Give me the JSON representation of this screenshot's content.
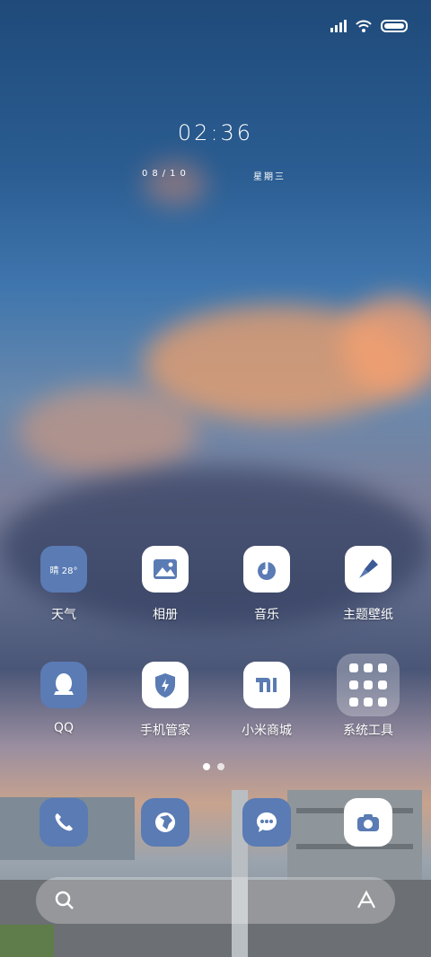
{
  "status": {
    "icons": [
      "signal-icon",
      "wifi-icon",
      "battery-icon"
    ]
  },
  "clock": {
    "time": "02:36"
  },
  "date": {
    "day": "08/10",
    "weekday": "星期三"
  },
  "apps": {
    "row1": [
      {
        "label": "天气",
        "weather_text": "晴 28°"
      },
      {
        "label": "相册"
      },
      {
        "label": "音乐"
      },
      {
        "label": "主题壁纸"
      }
    ],
    "row2": [
      {
        "label": "QQ"
      },
      {
        "label": "手机管家"
      },
      {
        "label": "小米商城"
      },
      {
        "label": "系统工具"
      }
    ]
  },
  "page_indicator": {
    "pages": 2,
    "current": 1
  },
  "dock": [
    "phone-icon",
    "browser-icon",
    "message-icon",
    "camera-icon"
  ],
  "search": {
    "left_icon": "search-icon",
    "right_icon": "assistant-icon"
  },
  "colors": {
    "accent_blue": "#5a7bb4",
    "icon_blue": "#3f6fd6"
  }
}
